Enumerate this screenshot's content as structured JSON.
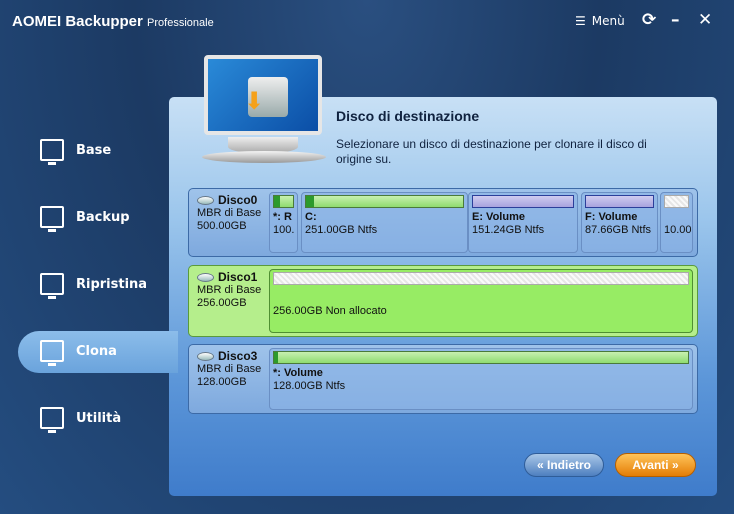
{
  "app": {
    "title": "AOMEI Backupper",
    "edition": "Professionale",
    "menu": "Menù"
  },
  "sidebar": {
    "items": [
      {
        "label": "Base"
      },
      {
        "label": "Backup"
      },
      {
        "label": "Ripristina"
      },
      {
        "label": "Clona",
        "active": true
      },
      {
        "label": "Utilità"
      }
    ]
  },
  "main": {
    "heading": "Disco di destinazione",
    "description": "Selezionare un disco di destinazione per clonare il disco di origine su."
  },
  "disks": [
    {
      "name": "Disco0",
      "type": "MBR di Base",
      "size": "500.00GB",
      "partitions": [
        {
          "label": "*: R",
          "info": "100.",
          "used": 0.3
        },
        {
          "label": "C:",
          "info": "251.00GB Ntfs",
          "used": 0.05
        },
        {
          "label": "E: Volume",
          "info": "151.24GB Ntfs"
        },
        {
          "label": "F: Volume",
          "info": "87.66GB Ntfs"
        },
        {
          "label": "",
          "info": "10.00"
        }
      ]
    },
    {
      "name": "Disco1",
      "type": "MBR di Base",
      "size": "256.00GB",
      "selected": true,
      "partitions": [
        {
          "label": "",
          "info": "256.00GB Non allocato"
        }
      ]
    },
    {
      "name": "Disco3",
      "type": "MBR di Base",
      "size": "128.00GB",
      "partitions": [
        {
          "label": "*: Volume",
          "info": "128.00GB Ntfs",
          "used": 0.01
        }
      ]
    }
  ],
  "buttons": {
    "back": "« Indietro",
    "next": "Avanti »"
  }
}
